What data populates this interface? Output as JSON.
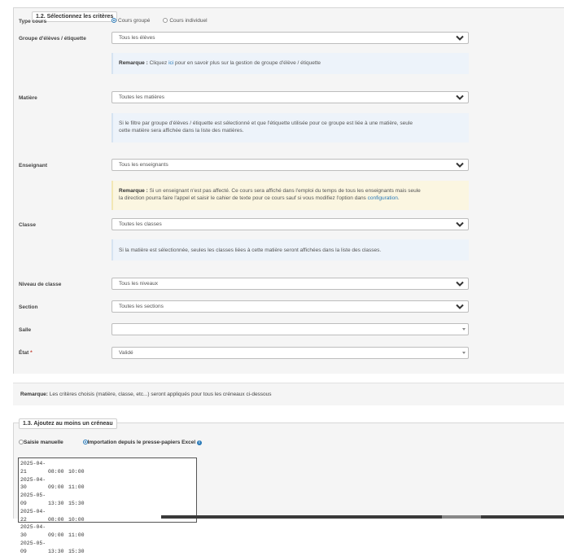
{
  "section1": {
    "title": "1.2. Sélectionnez les critères",
    "type_cours": {
      "label": "Type cours",
      "options": [
        "Cours groupé",
        "Cours individuel"
      ],
      "selected": "Cours groupé"
    },
    "groupe": {
      "label": "Groupe d'élèves / étiquette",
      "value": "Tous les élèves"
    },
    "groupe_note": {
      "prefix": "Remarque :",
      "pre": " Cliquez ",
      "link": "ici",
      "post": " pour en savoir plus sur la gestion de groupe d'élève / étiquette"
    },
    "matiere": {
      "label": "Matière",
      "value": "Toutes les matières"
    },
    "matiere_note": {
      "line1": "Si le filtre par groupe d'élèves / étiquette est sélectionné et que l'étiquette utilisée pour ce groupe est liée à une matière, seule",
      "line2": "cette matière sera affichée dans la liste des matières."
    },
    "enseignant": {
      "label": "Enseignant",
      "value": "Tous les enseignants"
    },
    "enseignant_note": {
      "prefix": "Remarque :",
      "line1": " Si un enseignant n'est pas affecté. Ce cours sera affiché dans l'emploi du temps de tous les enseignants mais seule",
      "line2": "la direction pourra faire l'appel et saisir le cahier de texte pour ce cours sauf si vous modifiez l'option dans ",
      "link": "configuration",
      "end": "."
    },
    "classe": {
      "label": "Classe",
      "value": "Toutes les classes"
    },
    "classe_note": "Si la matière est sélectionnée, seules les classes liées à cette matière seront affichées dans la liste des classes.",
    "niveau": {
      "label": "Niveau de classe",
      "value": "Tous les niveaux"
    },
    "section": {
      "label": "Section",
      "value": "Toutes les sections"
    },
    "salle": {
      "label": "Salle",
      "value": ""
    },
    "etat": {
      "label": "État",
      "required_mark": "*",
      "value": "Validé"
    }
  },
  "remark": {
    "prefix": "Remarque:",
    "text": " Les critères choisis (matière, classe, etc...) seront appliqués pour tous les créneaux ci-dessous"
  },
  "section2": {
    "title": "1.3. Ajoutez au moins un créneau",
    "modes": [
      "Saisie manuelle",
      "Importation depuis le presse-papiers Excel"
    ],
    "selected_mode": "Importation depuis le presse-papiers Excel",
    "slots": [
      {
        "date": "2025-04-21",
        "start": "08:00",
        "end": "10:00"
      },
      {
        "date": "2025-04-30",
        "start": "09:00",
        "end": "11:00"
      },
      {
        "date": "2025-05-09",
        "start": "13:30",
        "end": "15:30"
      },
      {
        "date": "2025-04-22",
        "start": "08:00",
        "end": "10:00"
      },
      {
        "date": "2025-04-30",
        "start": "09:00",
        "end": "11:00"
      },
      {
        "date": "2025-05-09",
        "start": "13:30",
        "end": "15:30"
      }
    ]
  },
  "icons": {
    "chevron": "chevron-down-icon",
    "info": "info-icon",
    "caret": "caret-down-icon"
  },
  "colors": {
    "accent": "#2a7ab8",
    "info_bg": "#edf3fa",
    "warn_bg": "#fbf6e1",
    "required": "#c0392b"
  }
}
